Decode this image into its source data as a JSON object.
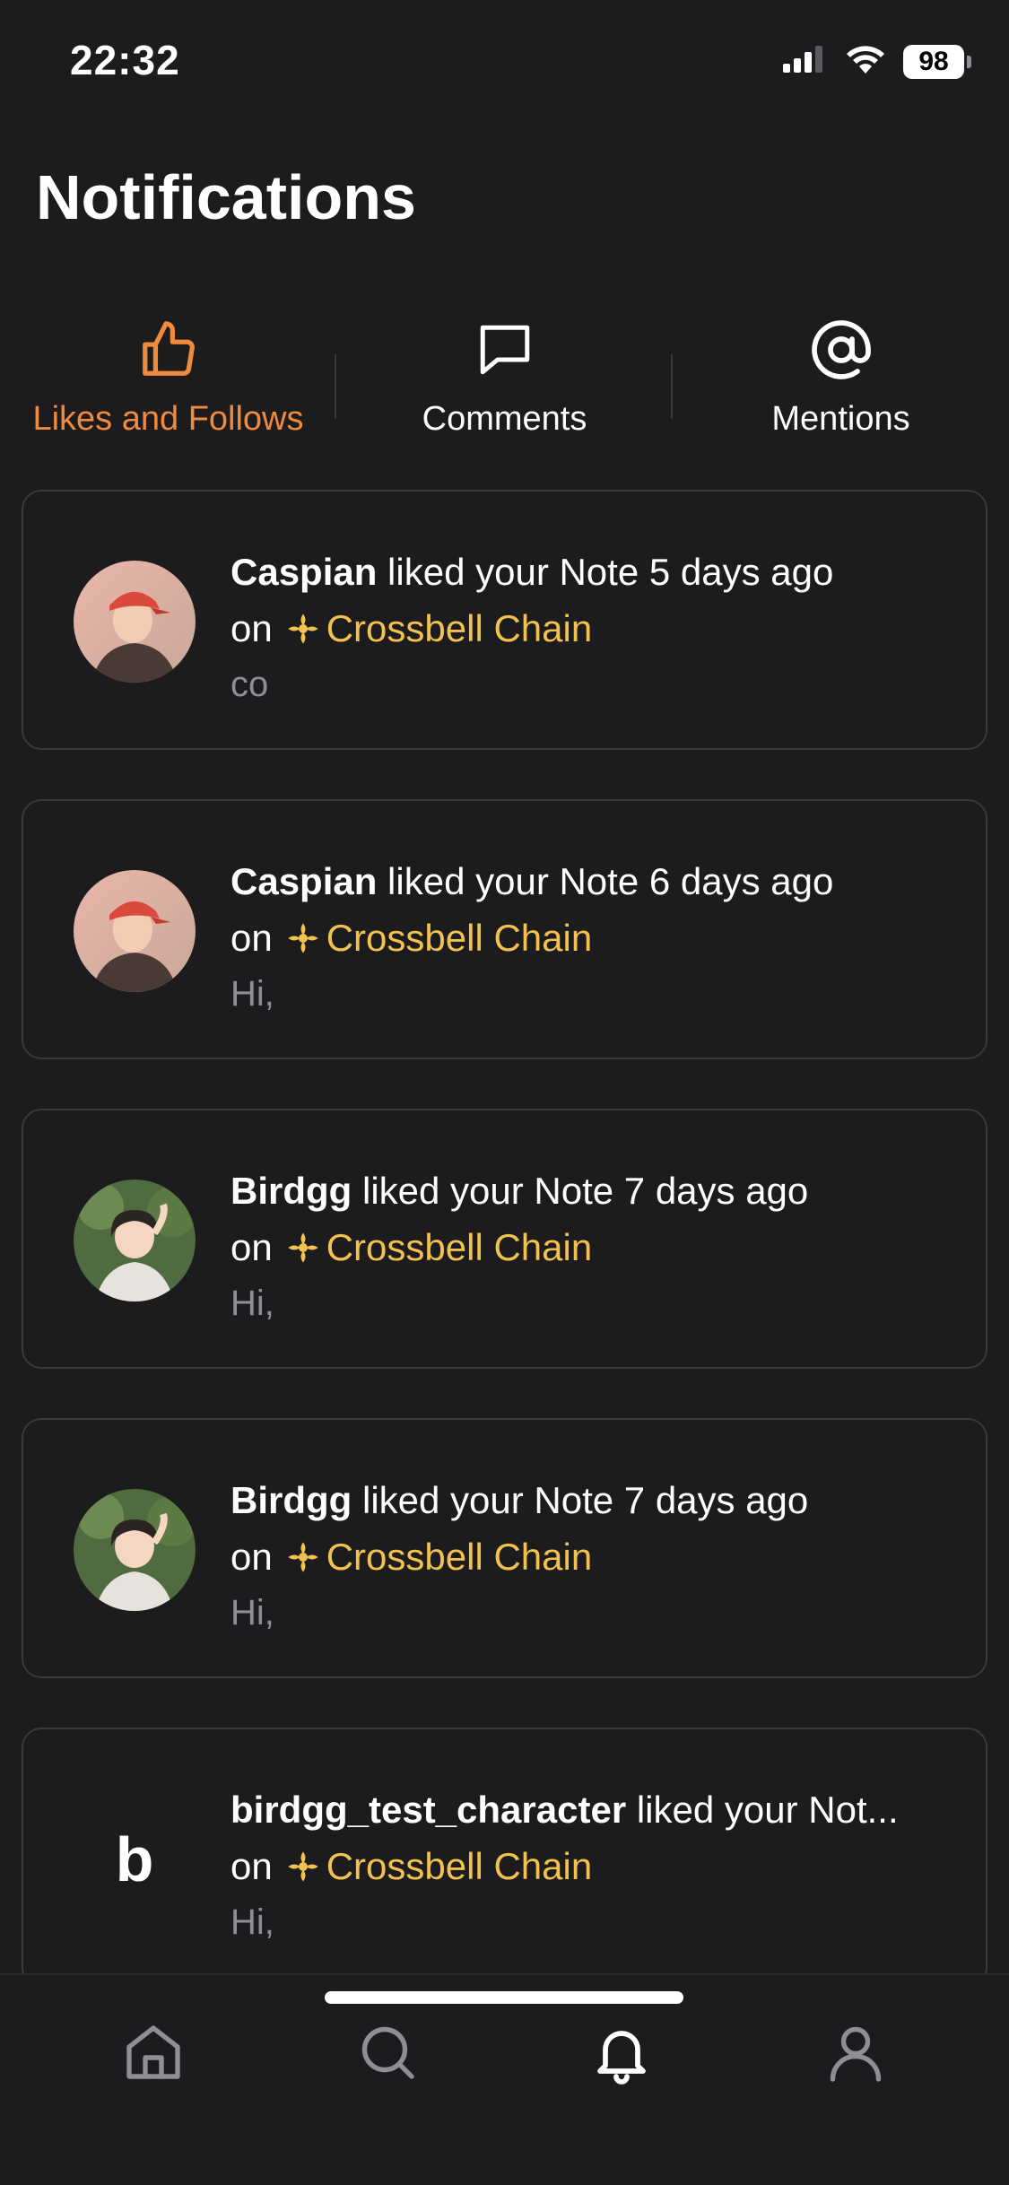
{
  "status_bar": {
    "time": "22:32",
    "battery": "98",
    "icons": [
      "signal-icon",
      "wifi-icon",
      "battery-icon"
    ]
  },
  "page": {
    "title": "Notifications"
  },
  "tabs": [
    {
      "label": "Likes and Follows",
      "icon": "thumbs-up-icon",
      "active": true
    },
    {
      "label": "Comments",
      "icon": "comment-icon",
      "active": false
    },
    {
      "label": "Mentions",
      "icon": "at-icon",
      "active": false
    }
  ],
  "notifications": [
    {
      "name": "Caspian",
      "action": " liked your Note 5 days ago",
      "on": "on",
      "chain": "Crossbell Chain",
      "preview": "co",
      "avatar": "caspian"
    },
    {
      "name": "Caspian",
      "action": " liked your Note 6 days ago",
      "on": "on",
      "chain": "Crossbell Chain",
      "preview": "Hi,",
      "avatar": "caspian"
    },
    {
      "name": "Birdgg",
      "action": " liked your Note 7 days ago",
      "on": "on",
      "chain": "Crossbell Chain",
      "preview": "Hi,",
      "avatar": "birdgg"
    },
    {
      "name": "Birdgg",
      "action": " liked your Note 7 days ago",
      "on": "on",
      "chain": "Crossbell Chain",
      "preview": "Hi,",
      "avatar": "birdgg"
    },
    {
      "name": "birdgg_test_character",
      "action": " liked your Not...",
      "on": "on",
      "chain": "Crossbell Chain",
      "preview": "Hi,",
      "avatar_letter": "b"
    }
  ],
  "bottom_nav": [
    {
      "icon": "home-icon",
      "active": false
    },
    {
      "icon": "search-icon",
      "active": false
    },
    {
      "icon": "bell-icon",
      "active": true
    },
    {
      "icon": "profile-icon",
      "active": false
    }
  ],
  "colors": {
    "background": "#1c1c1e",
    "accent": "#f08a3c",
    "chain": "#f2c14e",
    "muted": "#8e8e93",
    "border": "#3a3a3c"
  }
}
